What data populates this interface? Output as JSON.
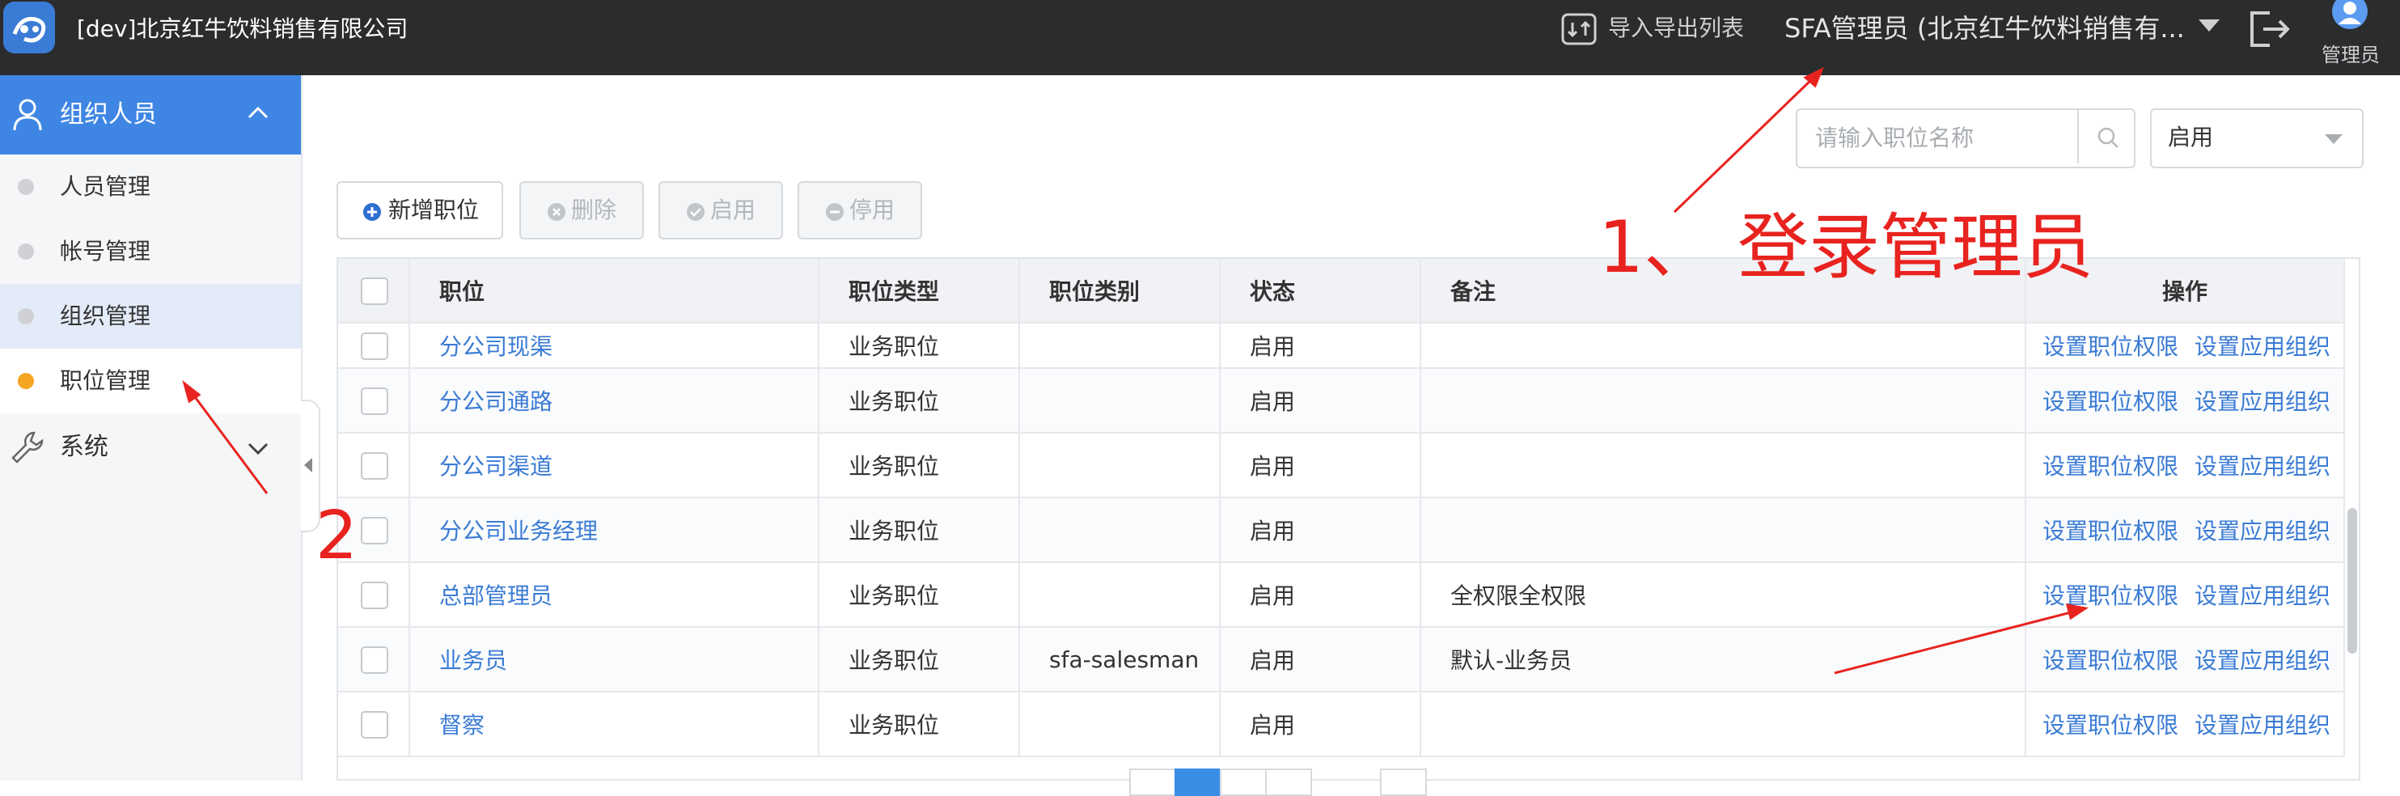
{
  "header": {
    "app_title": "[dev]北京红牛饮料销售有限公司",
    "import_export_label": "导入导出列表",
    "user_label": "SFA管理员 (北京红牛饮料销售有...",
    "admin_label": "管理员"
  },
  "sidebar": {
    "group_label": "组织人员",
    "items": [
      {
        "label": "人员管理"
      },
      {
        "label": "帐号管理"
      },
      {
        "label": "组织管理"
      },
      {
        "label": "职位管理"
      }
    ],
    "system_label": "系统"
  },
  "filters": {
    "search_placeholder": "请输入职位名称",
    "status_value": "启用"
  },
  "toolbar": {
    "add_label": "新增职位",
    "delete_label": "删除",
    "enable_label": "启用",
    "disable_label": "停用"
  },
  "table": {
    "headers": [
      "职位",
      "职位类型",
      "职位类别",
      "状态",
      "备注",
      "操作"
    ],
    "action_labels": [
      "设置职位权限",
      "设置应用组织"
    ],
    "rows": [
      {
        "name": "分公司现渠",
        "type": "业务职位",
        "category": "",
        "status": "启用",
        "remark": ""
      },
      {
        "name": "分公司通路",
        "type": "业务职位",
        "category": "",
        "status": "启用",
        "remark": ""
      },
      {
        "name": "分公司渠道",
        "type": "业务职位",
        "category": "",
        "status": "启用",
        "remark": ""
      },
      {
        "name": "分公司业务经理",
        "type": "业务职位",
        "category": "",
        "status": "启用",
        "remark": ""
      },
      {
        "name": "总部管理员",
        "type": "业务职位",
        "category": "",
        "status": "启用",
        "remark": "全权限全权限"
      },
      {
        "name": "业务员",
        "type": "业务职位",
        "category": "sfa-salesman",
        "status": "启用",
        "remark": "默认-业务员"
      },
      {
        "name": "督察",
        "type": "业务职位",
        "category": "",
        "status": "启用",
        "remark": ""
      }
    ]
  },
  "annotations": {
    "step1": "1、 登录管理员",
    "step2": "2"
  },
  "colors": {
    "topbar": "#2b2c2e",
    "accent": "#3f86e4",
    "link": "#3a7bd5",
    "annotation": "#e8231f",
    "active_dot": "#f5a623"
  }
}
